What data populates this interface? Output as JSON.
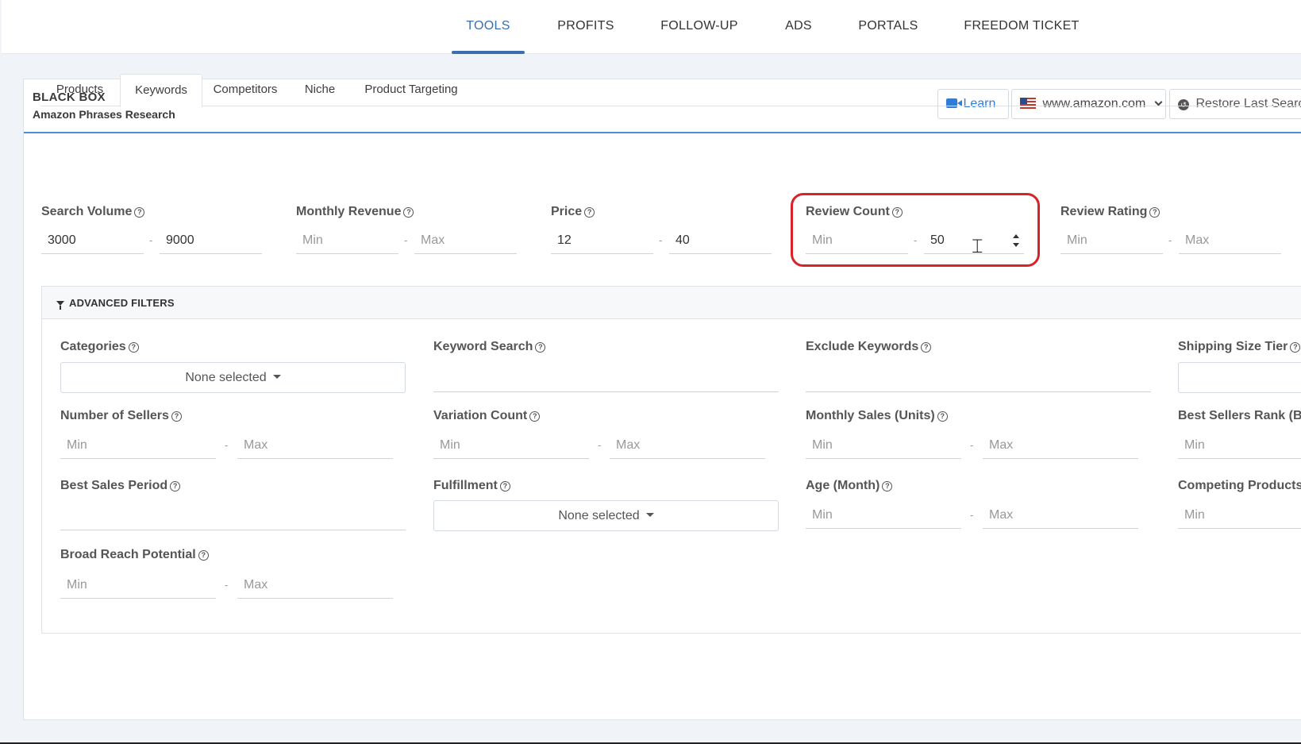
{
  "nav": {
    "tabs": [
      {
        "label": "TOOLS",
        "active": true
      },
      {
        "label": "PROFITS"
      },
      {
        "label": "FOLLOW-UP"
      },
      {
        "label": "ADS"
      },
      {
        "label": "PORTALS"
      },
      {
        "label": "FREEDOM TICKET"
      }
    ]
  },
  "header": {
    "title": "BLACK BOX",
    "subtitle": "Amazon Phrases Research",
    "learn_label": "Learn",
    "marketplace": "www.amazon.com",
    "restore_label": "Restore Last Search",
    "icons": {
      "learn": "video-camera-icon",
      "marketplace": "us-flag-icon",
      "restore": "restore-icon"
    }
  },
  "tabs": [
    {
      "label": "Products"
    },
    {
      "label": "Keywords",
      "active": true
    },
    {
      "label": "Competitors"
    },
    {
      "label": "Niche"
    },
    {
      "label": "Product Targeting"
    }
  ],
  "filters": {
    "search_volume": {
      "label": "Search Volume",
      "min": "3000",
      "max": "9000"
    },
    "monthly_revenue": {
      "label": "Monthly Revenue",
      "min": "",
      "max": ""
    },
    "price": {
      "label": "Price",
      "min": "12",
      "max": "40"
    },
    "review_count": {
      "label": "Review Count",
      "min": "",
      "max": "50"
    },
    "review_rating": {
      "label": "Review Rating",
      "min": "",
      "max": ""
    },
    "placeholder_min": "Min",
    "placeholder_max": "Max",
    "dash": "-"
  },
  "advanced": {
    "title": "ADVANCED FILTERS",
    "categories": {
      "label": "Categories",
      "value": "None selected"
    },
    "keyword_search": {
      "label": "Keyword Search",
      "value": ""
    },
    "exclude_keywords": {
      "label": "Exclude Keywords",
      "value": ""
    },
    "shipping_size_tier": {
      "label": "Shipping Size Tier",
      "value": ""
    },
    "number_of_sellers": {
      "label": "Number of Sellers"
    },
    "variation_count": {
      "label": "Variation Count"
    },
    "monthly_sales": {
      "label": "Monthly Sales (Units)"
    },
    "best_sellers_rank": {
      "label": "Best Sellers Rank (BSR)"
    },
    "best_sales_period": {
      "label": "Best Sales Period",
      "value": ""
    },
    "fulfillment": {
      "label": "Fulfillment",
      "value": "None selected"
    },
    "age_month": {
      "label": "Age (Month)"
    },
    "competing_products": {
      "label": "Competing Products"
    },
    "broad_reach_potential": {
      "label": "Broad Reach Potential"
    }
  },
  "colors": {
    "accent": "#3b6fb0",
    "highlight": "#d8232a",
    "learn": "#2f7dd7"
  }
}
